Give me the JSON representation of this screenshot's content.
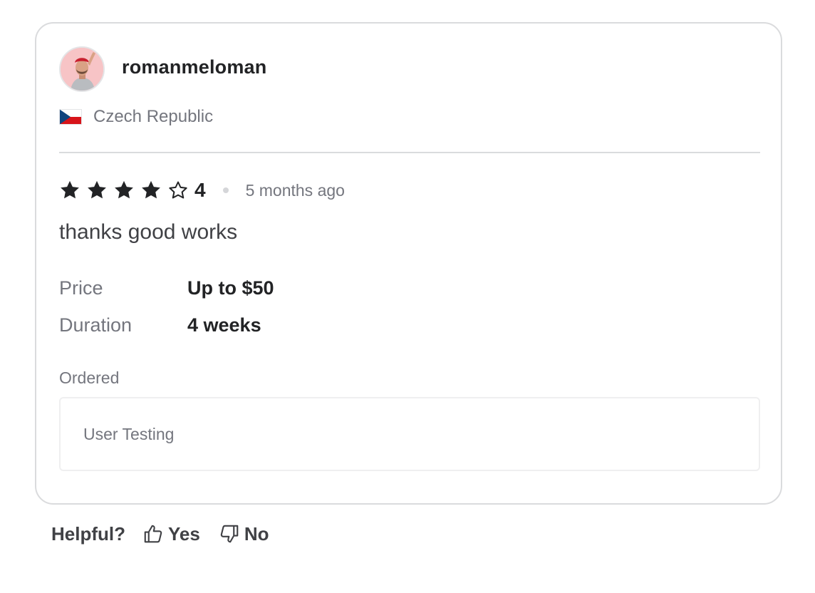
{
  "review": {
    "username": "romanmeloman",
    "country": "Czech Republic",
    "rating": 4,
    "rating_label": "4",
    "time_ago": "5 months ago",
    "text": "thanks good works",
    "details": {
      "price_label": "Price",
      "price_value": "Up to $50",
      "duration_label": "Duration",
      "duration_value": "4 weeks"
    },
    "ordered_label": "Ordered",
    "ordered_item": "User Testing"
  },
  "helpful": {
    "label": "Helpful?",
    "yes_label": "Yes",
    "no_label": "No"
  },
  "icons": {
    "avatar": "user-avatar-photo",
    "flag": "czech-flag-icon",
    "star_filled": "star-filled-icon",
    "star_empty": "star-empty-icon",
    "thumbs_up": "thumbs-up-icon",
    "thumbs_down": "thumbs-down-icon"
  },
  "colors": {
    "text_primary": "#222325",
    "text_secondary": "#74767e",
    "border": "#dadbdd",
    "star": "#222325"
  }
}
